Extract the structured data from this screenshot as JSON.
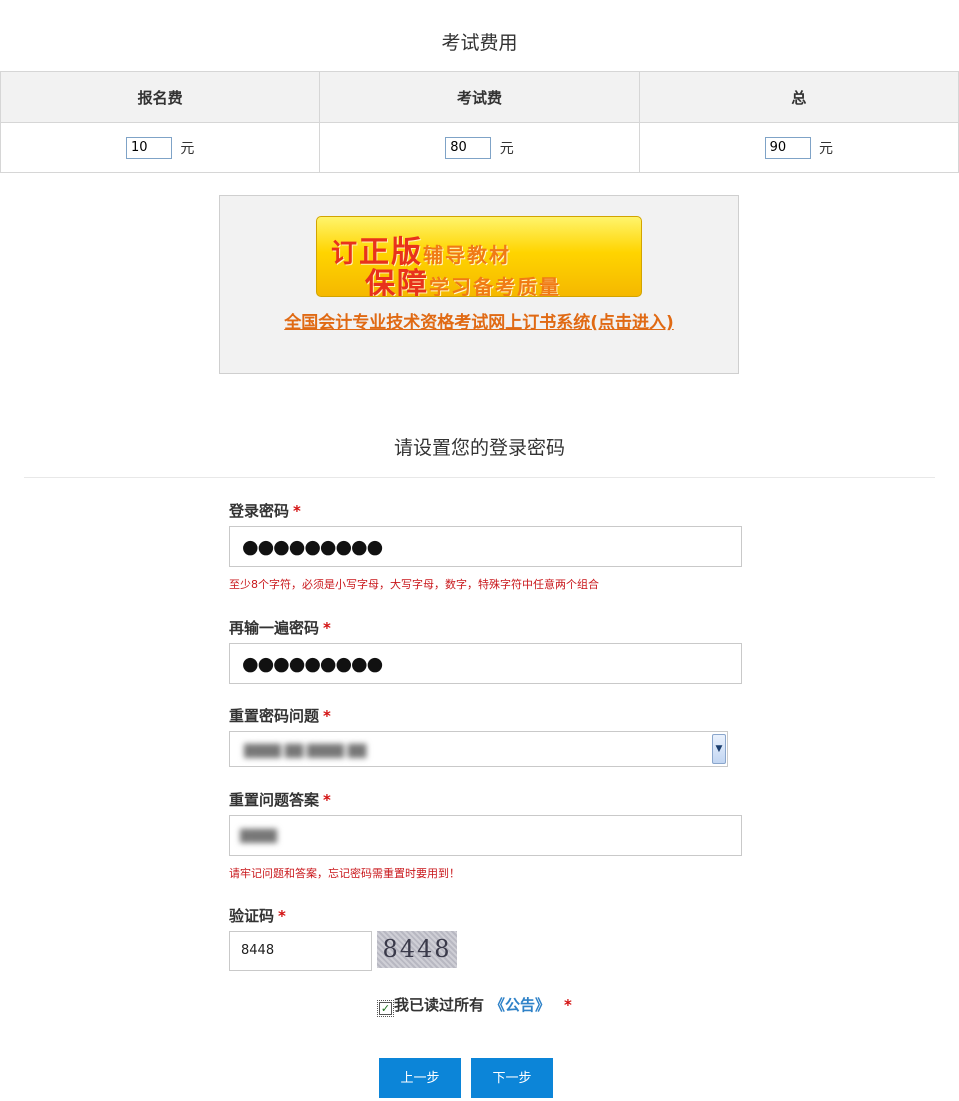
{
  "fees": {
    "title": "考试费用",
    "headers": [
      "报名费",
      "考试费",
      "总"
    ],
    "values": [
      "10",
      "80",
      "90"
    ],
    "unit": "元"
  },
  "promo": {
    "banner_line1": [
      "订",
      "正版",
      "辅导教材"
    ],
    "banner_line2": [
      "保障",
      "学习备考质量"
    ],
    "link_text": "全国会计专业技术资格考试网上订书系统(点击进入)"
  },
  "form": {
    "section_title": "请设置您的登录密码",
    "required_mark": "*",
    "password": {
      "label": "登录密码",
      "masked_value": "●●●●●●●●●",
      "hint": "至少8个字符，必须是小写字母，大写字母，数字，特殊字符中任意两个组合"
    },
    "confirm_password": {
      "label": "再输一遍密码",
      "masked_value": "●●●●●●●●●"
    },
    "reset_question": {
      "label": "重置密码问题",
      "selected_value": "(blurred)"
    },
    "reset_answer": {
      "label": "重置问题答案",
      "value": "(blurred)",
      "hint": "请牢记问题和答案，忘记密码需重置时要用到！"
    },
    "captcha": {
      "label": "验证码",
      "value": "8448",
      "image_text": "8448"
    },
    "agreement": {
      "checked": true,
      "text": "我已读过所有",
      "link_text": "《公告》"
    }
  },
  "buttons": {
    "prev": "上一步",
    "next": "下一步"
  },
  "colors": {
    "primary_button": "#0c85d8",
    "required": "#d31111",
    "link_orange": "#e06a14",
    "link_blue": "#2f82c8"
  }
}
